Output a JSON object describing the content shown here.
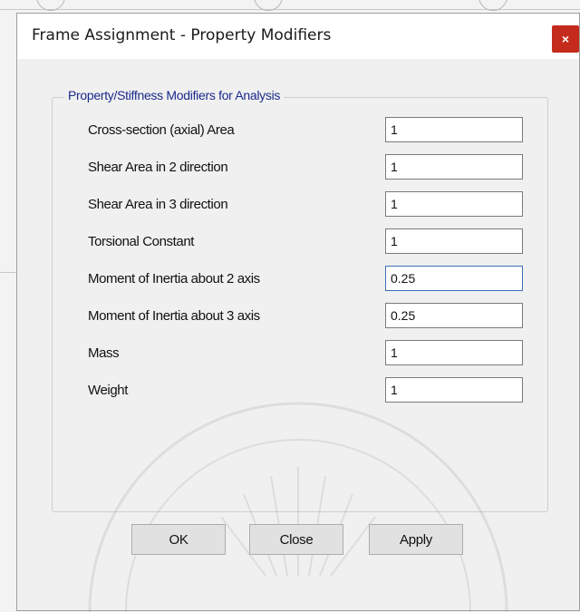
{
  "window": {
    "title": "Frame Assignment - Property Modifiers",
    "close_glyph": "×"
  },
  "group": {
    "label": "Property/Stiffness Modifiers for Analysis"
  },
  "modifiers": [
    {
      "label": "Cross-section (axial) Area",
      "value": "1"
    },
    {
      "label": "Shear Area in 2 direction",
      "value": "1"
    },
    {
      "label": "Shear Area in 3 direction",
      "value": "1"
    },
    {
      "label": "Torsional Constant",
      "value": "1"
    },
    {
      "label": "Moment of Inertia about 2 axis",
      "value": "0.25"
    },
    {
      "label": "Moment of Inertia about 3 axis",
      "value": "0.25"
    },
    {
      "label": "Mass",
      "value": "1"
    },
    {
      "label": "Weight",
      "value": "1"
    }
  ],
  "buttons": {
    "ok": "OK",
    "close": "Close",
    "apply": "Apply"
  },
  "colors": {
    "group_label": "#1b2a8c",
    "close_button": "#c42b1c",
    "focus_border": "#3b6fb6"
  },
  "icons": {
    "close": "close-icon"
  }
}
